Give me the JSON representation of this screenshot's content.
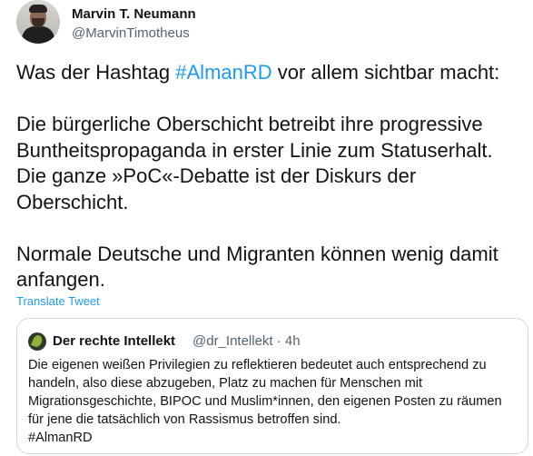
{
  "author": {
    "name": "Marvin T. Neumann",
    "handle": "@MarvinTimotheus"
  },
  "tweet": {
    "line1_prefix": "Was der Hashtag ",
    "line1_hashtag": "#AlmanRD",
    "line1_suffix": " vor allem sichtbar macht:",
    "para2": "Die bürgerliche Oberschicht betreibt ihre progressive Buntheitspropaganda in erster Linie zum Statuserhalt. Die ganze »PoC«-Debatte ist der Diskurs der Oberschicht.",
    "para3": "Normale Deutsche und Migranten können wenig damit anfangen.",
    "translate_label": "Translate Tweet"
  },
  "quote": {
    "name": "Der rechte Intellekt",
    "handle_time": "@dr_Intellekt · 4h",
    "text": "Die eigenen weißen Privilegien zu reflektieren bedeutet auch entsprechend zu handeln, also diese abzugeben, Platz zu machen für Menschen mit Migrationsgeschichte, BIPOC und Muslim*innen, den eigenen Posten zu räumen für jene die tatsächlich von Rassismus betroffen sind.",
    "hashtag": "#AlmanRD"
  },
  "colors": {
    "link": "#1d9bf0",
    "secondary_text": "#536471",
    "primary_text": "#0f1419",
    "border": "#cfd9de"
  }
}
